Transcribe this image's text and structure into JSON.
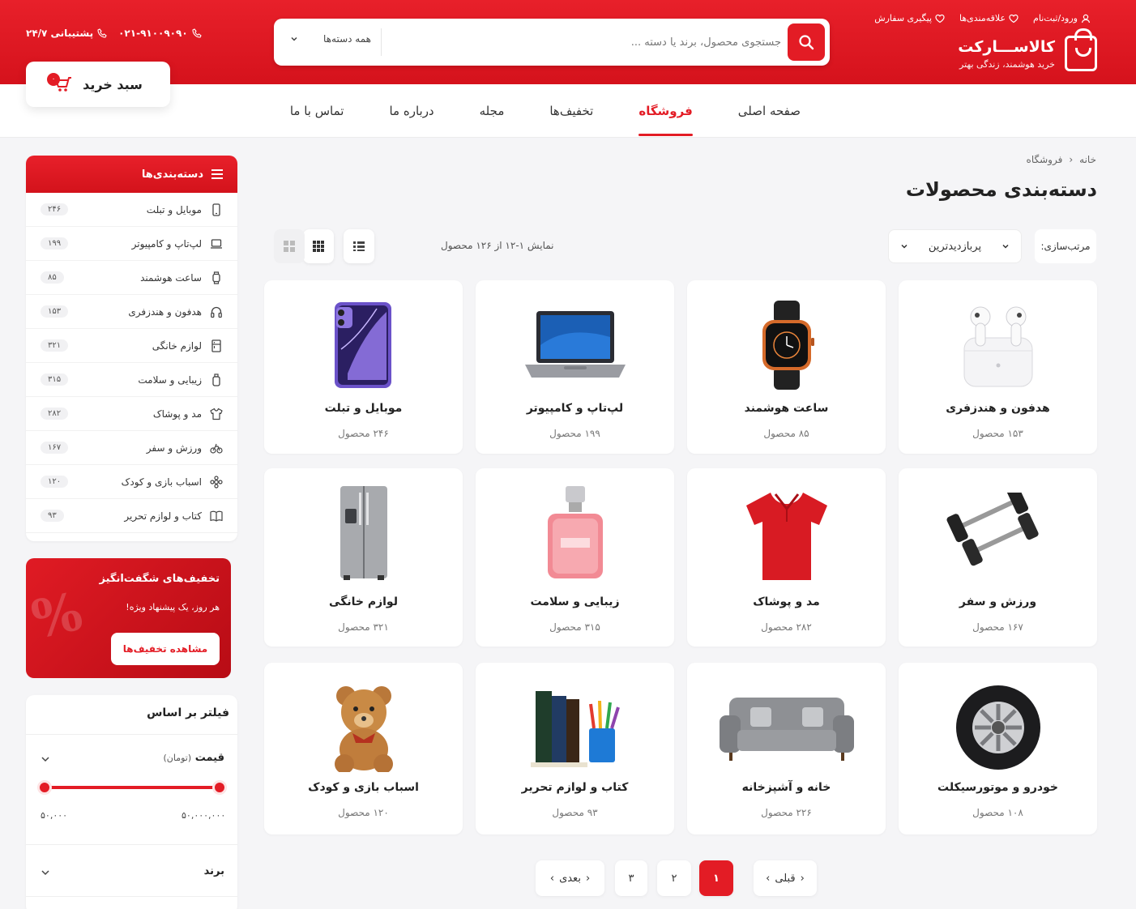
{
  "header": {
    "logo_name": "کالاســـارکت",
    "logo_tagline": "خرید هوشمند، زندگی بهتر",
    "top_links": [
      {
        "label": "ورود/ثبت‌نام",
        "icon": "user-icon"
      },
      {
        "label": "علاقه‌مندی‌ها",
        "icon": "heart-icon"
      },
      {
        "label": "پیگیری سفارش",
        "icon": "heart-icon"
      }
    ],
    "search_placeholder": "جستجوی محصول، برند یا دسته ...",
    "search_category": "همه دسته‌ها",
    "phone": "۰۲۱-۹۱۰۰۹۰۹۰",
    "support": "پشتیبانی ۲۴/۷",
    "cart_label": "سبد خرید",
    "cart_count": "۰"
  },
  "nav": [
    {
      "label": "صفحه اصلی",
      "active": false
    },
    {
      "label": "فروشگاه",
      "active": true
    },
    {
      "label": "تخفیف‌ها",
      "active": false
    },
    {
      "label": "مجله",
      "active": false
    },
    {
      "label": "درباره ما",
      "active": false
    },
    {
      "label": "تماس با ما",
      "active": false
    }
  ],
  "sidebar": {
    "title": "دسته‌بندی‌ها",
    "categories": [
      {
        "label": "موبایل و تبلت",
        "count": "۲۴۶",
        "icon": "mobile-icon"
      },
      {
        "label": "لپ‌تاپ و کامپیوتر",
        "count": "۱۹۹",
        "icon": "laptop-icon"
      },
      {
        "label": "ساعت هوشمند",
        "count": "۸۵",
        "icon": "watch-icon"
      },
      {
        "label": "هدفون و هندزفری",
        "count": "۱۵۳",
        "icon": "headphone-icon"
      },
      {
        "label": "لوازم خانگی",
        "count": "۳۲۱",
        "icon": "appliance-icon"
      },
      {
        "label": "زیبایی و سلامت",
        "count": "۳۱۵",
        "icon": "beauty-icon"
      },
      {
        "label": "مد و پوشاک",
        "count": "۲۸۲",
        "icon": "shirt-icon"
      },
      {
        "label": "ورزش و سفر",
        "count": "۱۶۷",
        "icon": "bike-icon"
      },
      {
        "label": "اسباب بازی و کودک",
        "count": "۱۲۰",
        "icon": "toy-icon"
      },
      {
        "label": "کتاب و لوازم تحریر",
        "count": "۹۳",
        "icon": "book-icon"
      }
    ]
  },
  "promo": {
    "title": "تخفیف‌های شگفت‌انگیز",
    "subtitle": "هر روز، یک پیشنهاد ویژه!",
    "button": "مشاهده تخفیف‌ها",
    "decor": "%"
  },
  "filter": {
    "title": "فیلتر بر اساس",
    "price_label": "قیمت",
    "price_unit": "(تومان)",
    "price_min": "۵۰,۰۰۰",
    "price_max": "۵۰,۰۰۰,۰۰۰",
    "brand_label": "برند"
  },
  "main": {
    "breadcrumb": [
      "خانه",
      "فروشگاه"
    ],
    "title": "دسته‌بندی محصولات",
    "sort_label": "مرتب‌سازی:",
    "sort_value": "پربازدیدترین",
    "result_text": "نمایش ۱-۱۲ از ۱۲۶ محصول"
  },
  "products": [
    {
      "name": "هدفون و هندزفری",
      "count": "۱۵۳ محصول",
      "icon": "earbuds-image"
    },
    {
      "name": "ساعت هوشمند",
      "count": "۸۵ محصول",
      "icon": "smartwatch-image"
    },
    {
      "name": "لپ‌تاپ و کامپیوتر",
      "count": "۱۹۹ محصول",
      "icon": "laptop-image"
    },
    {
      "name": "موبایل و تبلت",
      "count": "۲۴۶ محصول",
      "icon": "phone-image"
    },
    {
      "name": "ورزش و سفر",
      "count": "۱۶۷ محصول",
      "icon": "dumbbell-image"
    },
    {
      "name": "مد و پوشاک",
      "count": "۲۸۲ محصول",
      "icon": "tshirt-image"
    },
    {
      "name": "زیبایی و سلامت",
      "count": "۳۱۵ محصول",
      "icon": "perfume-image"
    },
    {
      "name": "لوازم خانگی",
      "count": "۳۲۱ محصول",
      "icon": "fridge-image"
    },
    {
      "name": "خودرو و موتورسیکلت",
      "count": "۱۰۸ محصول",
      "icon": "tire-image"
    },
    {
      "name": "خانه و آشپزخانه",
      "count": "۲۲۶ محصول",
      "icon": "sofa-image"
    },
    {
      "name": "کتاب و لوازم تحریر",
      "count": "۹۳ محصول",
      "icon": "books-image"
    },
    {
      "name": "اسباب بازی و کودک",
      "count": "۱۲۰ محصول",
      "icon": "teddy-image"
    }
  ],
  "pagination": {
    "prev": "قبلی",
    "next": "بعدی",
    "pages": [
      "۱",
      "۲",
      "۳"
    ],
    "current": "۱"
  },
  "colors": {
    "accent": "#e31c25",
    "background": "#f5f5f7"
  }
}
